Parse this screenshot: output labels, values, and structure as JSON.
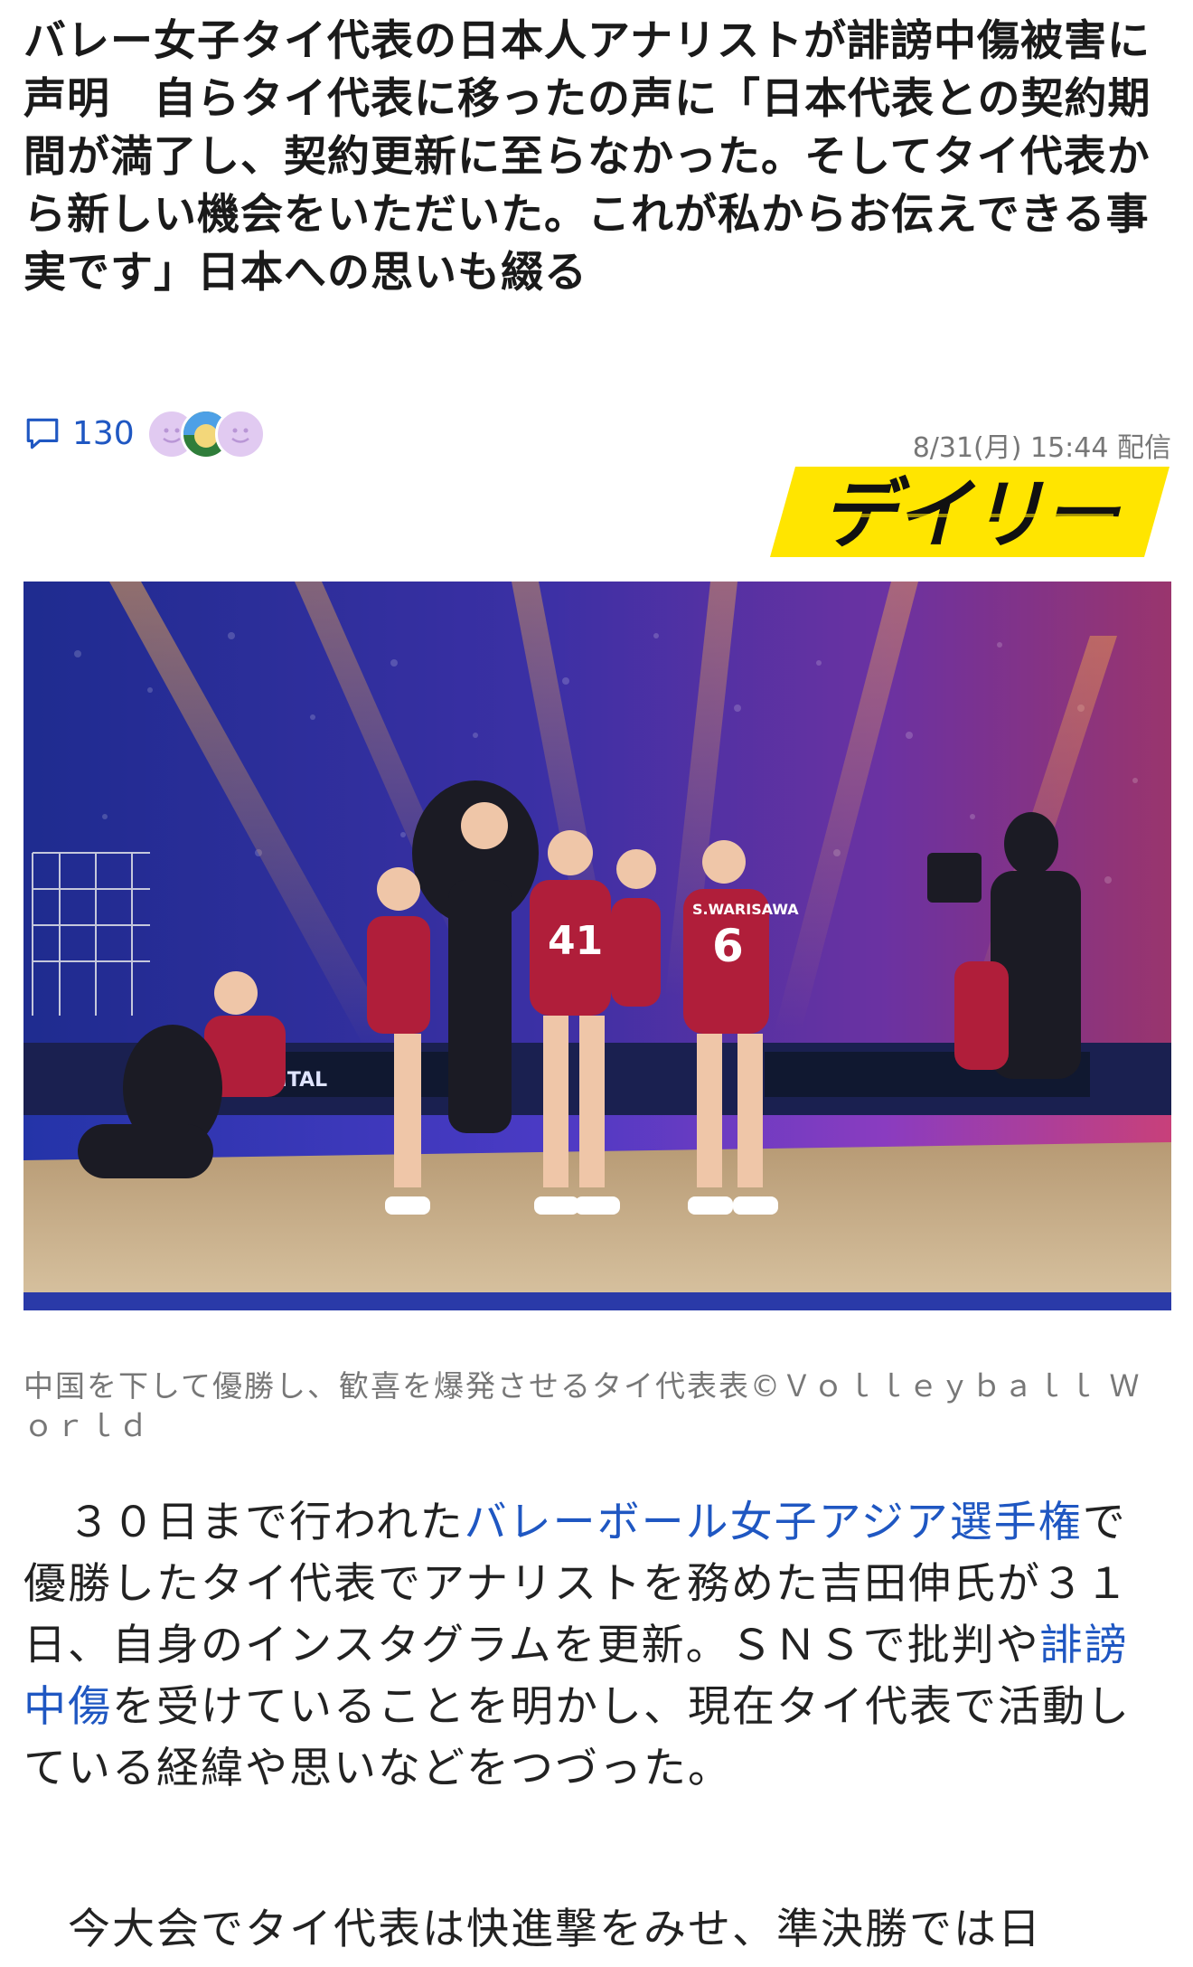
{
  "article": {
    "title": "バレー女子タイ代表の日本人アナリストが誹謗中傷被害に声明　自らタイ代表に移ったの声に「日本代表との契約期間が満了し、契約更新に至らなかった。そしてタイ代表から新しい機会をいただいた。これが私からお伝えできる事実です」日本への思いも綴る",
    "comment_count": "130",
    "timestamp": "8/31(月) 15:44 配信",
    "publisher_logo_text": "デイリー",
    "photo": {
      "caption": "中国を下して優勝し、歓喜を爆発させるタイ代表表©Ｖｏｌｌｅｙｂａｌｌ Ｗｏｒｌｄ",
      "jersey_numbers": [
        "41",
        "6"
      ],
      "jersey_name": "S.WARISAWA",
      "banner_text": "NENTAL"
    },
    "paragraph1": {
      "part1": "　３０日まで行われた",
      "link1": "バレーボール女子アジア選手権",
      "part2": "で優勝したタイ代表でアナリストを務めた吉田伸氏が３１日、自身のインスタグラムを更新。ＳＮＳで批判や",
      "link2": "誹謗中傷",
      "part3": "を受けていることを明かし、現在タイ代表で活動している経緯や思いなどをつづった。"
    },
    "paragraph2": {
      "text": "　今大会でタイ代表は快進撃をみせ、準決勝では日"
    }
  },
  "colors": {
    "link": "#1f57c2",
    "logo_yellow": "#ffe500",
    "logo_black": "#111111",
    "jersey_red": "#b01e3a",
    "stage_blue": "#2a3aa8"
  },
  "icons": {
    "comment": "speech-bubble-icon",
    "reactions": [
      "smile-reaction-icon",
      "photo-avatar-icon",
      "smile-reaction-icon"
    ]
  }
}
